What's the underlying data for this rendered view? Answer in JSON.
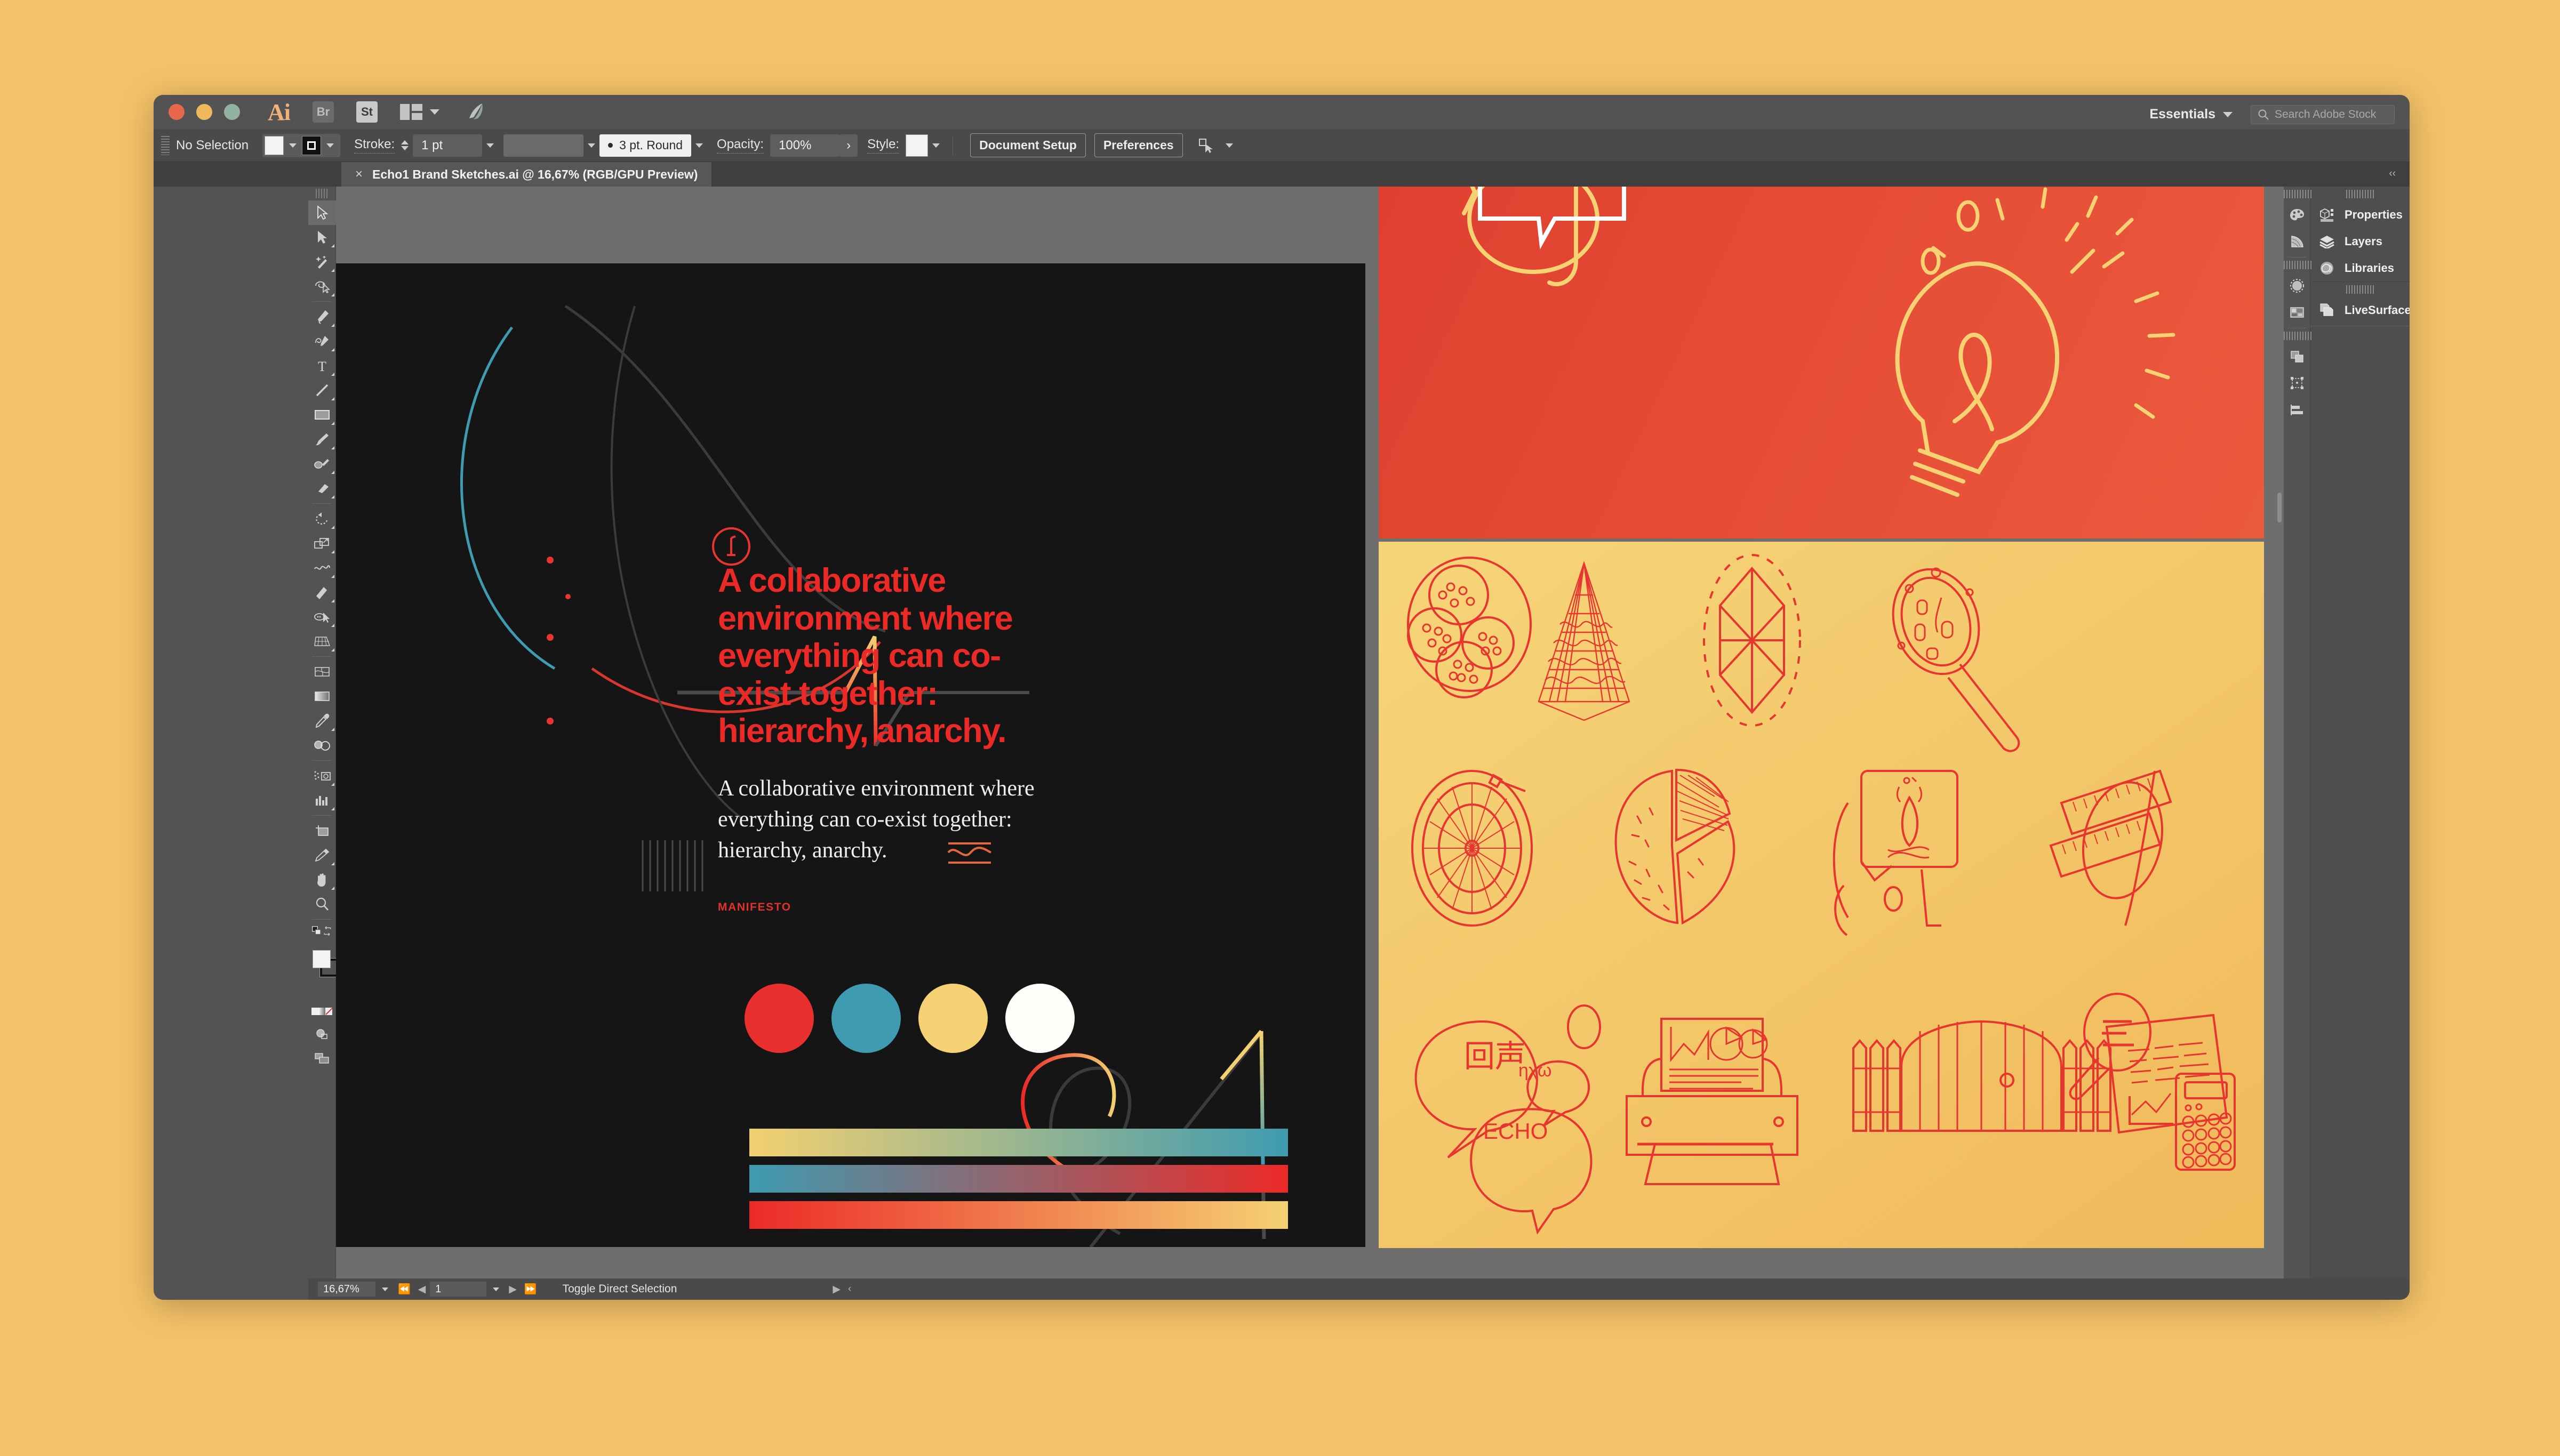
{
  "app": {
    "name": "Adobe Illustrator",
    "logo_text": "Ai",
    "bridge_chip": "Br",
    "stock_chip": "St"
  },
  "titlebar": {
    "workspace": "Essentials",
    "search_placeholder": "Search Adobe Stock",
    "icons": [
      "close-icon",
      "minimize-icon",
      "zoom-icon",
      "ai-logo-icon",
      "bridge-icon",
      "stock-chip-icon",
      "arrange-documents-icon",
      "rocket-icon",
      "workspace-chevron-icon",
      "properties-chevron-icon",
      "menu-list-icon"
    ]
  },
  "optionsbar": {
    "selection_status": "No Selection",
    "fill_label": "fill-swatch",
    "stroke_swatch_label": "stroke-swatch",
    "stroke_label": "Stroke:",
    "stroke_weight": "1 pt",
    "stroke_profile": "uniform-profile",
    "brush_definition": "3 pt. Round",
    "opacity_label": "Opacity:",
    "opacity_value": "100%",
    "style_label": "Style:",
    "document_setup": "Document Setup",
    "preferences": "Preferences"
  },
  "document_tab": {
    "close": "×",
    "title": "Echo1 Brand Sketches.ai @ 16,67% (RGB/GPU Preview)",
    "right_meta": "‹‹"
  },
  "toolbox": {
    "tools": [
      {
        "name": "selection-tool",
        "active": true
      },
      {
        "name": "direct-selection-tool",
        "active": false
      },
      {
        "name": "magic-wand-tool",
        "active": false
      },
      {
        "name": "lasso-tool",
        "active": false
      },
      {
        "name": "pen-tool",
        "active": false
      },
      {
        "name": "curvature-tool",
        "active": false
      },
      {
        "name": "type-tool",
        "active": false
      },
      {
        "name": "line-segment-tool",
        "active": false
      },
      {
        "name": "rectangle-tool",
        "active": false
      },
      {
        "name": "paintbrush-tool",
        "active": false
      },
      {
        "name": "shaper-pencil-tool",
        "active": false
      },
      {
        "name": "eraser-tool",
        "active": false
      },
      {
        "name": "rotate-tool",
        "active": false
      },
      {
        "name": "scale-tool",
        "active": false
      },
      {
        "name": "width-tool",
        "active": false
      },
      {
        "name": "free-transform-tool",
        "active": false
      },
      {
        "name": "shape-builder-tool",
        "active": false
      },
      {
        "name": "perspective-grid-tool",
        "active": false
      },
      {
        "name": "mesh-tool",
        "active": false
      },
      {
        "name": "gradient-tool",
        "active": false
      },
      {
        "name": "eyedropper-tool",
        "active": false
      },
      {
        "name": "blend-tool",
        "active": false
      },
      {
        "name": "symbol-sprayer-tool",
        "active": false
      },
      {
        "name": "column-graph-tool",
        "active": false
      },
      {
        "name": "artboard-tool",
        "active": false
      },
      {
        "name": "slice-tool",
        "active": false
      },
      {
        "name": "hand-tool",
        "active": false
      },
      {
        "name": "zoom-tool",
        "active": false
      }
    ],
    "fill_color": "#f3f3f3",
    "stroke_color": "#111111"
  },
  "artwork": {
    "dark_board": {
      "background": "#151515",
      "logo_mark": "circled-i-logo-icon",
      "headline": "A collaborative environment where everything can co-exist together: hierarchy, anarchy.",
      "headline_color": "#eb2a28",
      "body": "A collaborative environment where everything can co-exist together: hierarchy, anarchy.",
      "body_color": "#efefef",
      "section_label": "MANIFESTO",
      "section_label_color": "#e0332e",
      "palette": [
        {
          "name": "brand-red",
          "hex": "#e8312e"
        },
        {
          "name": "brand-teal",
          "hex": "#3f9bb0"
        },
        {
          "name": "brand-yellow",
          "hex": "#f5d173"
        },
        {
          "name": "brand-white",
          "hex": "#fdfdfa"
        }
      ],
      "gradient_bars": [
        {
          "name": "yellow-to-teal",
          "from": "#f3d071",
          "to": "#3f9bb0"
        },
        {
          "name": "teal-to-red",
          "from": "#3f9bb0",
          "to": "#ec2a28"
        },
        {
          "name": "red-to-yellow",
          "from": "#ec2a28",
          "to": "#f5d173"
        }
      ],
      "sketch_elements": [
        "pulse-waveform-icon",
        "hatch-lines-icon",
        "wave-glyph-icon",
        "loop-curve-icon",
        "spike-curve-icon",
        "teal-arc-icon",
        "grey-arc-icon"
      ]
    },
    "red_board": {
      "background_from": "#e04030",
      "background_to": "#ea5a3d",
      "line_color": "#f6d273",
      "elements": [
        "speech-bubble-icon",
        "lightbulb-icon",
        "sparkle-rays-icon"
      ]
    },
    "yellow_board": {
      "background_from": "#f6d579",
      "background_to": "#f0b95a",
      "line_color": "#e8352f",
      "rows": [
        [
          "petri-dish-icon",
          "pyramid-mesh-icon",
          "gem-facet-icon",
          "magnifier-specimen-icon"
        ],
        [
          "bicycle-wheel-icon",
          "pie-chart-icon",
          "campfire-sign-icon",
          "crossed-rulers-icon"
        ],
        [
          "echo-speech-bubbles-icon",
          "printer-icon",
          "picket-fence-gate-icon",
          "audit-document-icon"
        ]
      ],
      "speech_bubbles": [
        {
          "name": "bubble-chinese",
          "text": "回声"
        },
        {
          "name": "bubble-greek",
          "text": "ηχώ"
        },
        {
          "name": "bubble-english",
          "text": "ECHO"
        }
      ]
    }
  },
  "panels": {
    "items": [
      {
        "label": "Properties",
        "icon": "properties-panel-icon"
      },
      {
        "label": "Layers",
        "icon": "layers-panel-icon"
      },
      {
        "label": "Libraries",
        "icon": "libraries-panel-icon"
      }
    ],
    "secondary": [
      {
        "label": "LiveSurface",
        "icon": "livesurface-panel-icon"
      }
    ],
    "rail_icons": [
      "color-panel-icon",
      "color-guide-icon",
      "brushes-panel-icon",
      "swatches-panel-icon",
      "pathfinder-panel-icon",
      "transform-panel-icon",
      "align-panel-icon"
    ]
  },
  "statusbar": {
    "zoom": "16,67%",
    "artboard_number": "1",
    "status_text": "Toggle Direct Selection",
    "nav_icons": [
      "first-artboard-icon",
      "previous-artboard-icon",
      "next-artboard-icon",
      "last-artboard-icon"
    ]
  }
}
